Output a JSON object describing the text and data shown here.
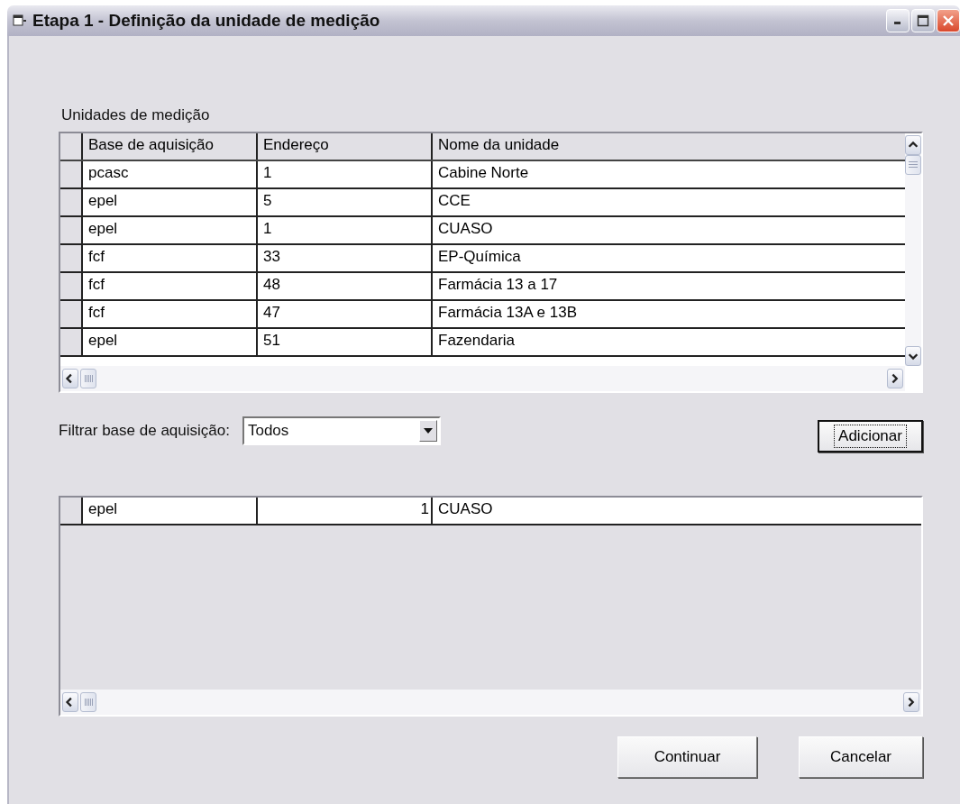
{
  "window": {
    "title": "Etapa 1 - Definição da unidade de medição"
  },
  "units_label": "Unidades de medição",
  "units_table": {
    "columns": [
      "Base de aquisição",
      "Endereço",
      "Nome da unidade"
    ],
    "rows": [
      [
        "pcasc",
        "1",
        "Cabine Norte"
      ],
      [
        "epel",
        "5",
        "CCE"
      ],
      [
        "epel",
        "1",
        "CUASO"
      ],
      [
        "fcf",
        "33",
        "EP-Química"
      ],
      [
        "fcf",
        "48",
        "Farmácia 13 a 17"
      ],
      [
        "fcf",
        "47",
        "Farmácia 13A e 13B"
      ],
      [
        "epel",
        "51",
        "Fazendaria"
      ]
    ]
  },
  "filter": {
    "label": "Filtrar base de aquisição:",
    "value": "Todos"
  },
  "add_button": {
    "label": "Adicionar",
    "focused": true
  },
  "selected_table": {
    "rows": [
      [
        "epel",
        "1",
        "CUASO"
      ]
    ]
  },
  "buttons": [
    {
      "label": "Continuar"
    },
    {
      "label": "Cancelar"
    }
  ]
}
